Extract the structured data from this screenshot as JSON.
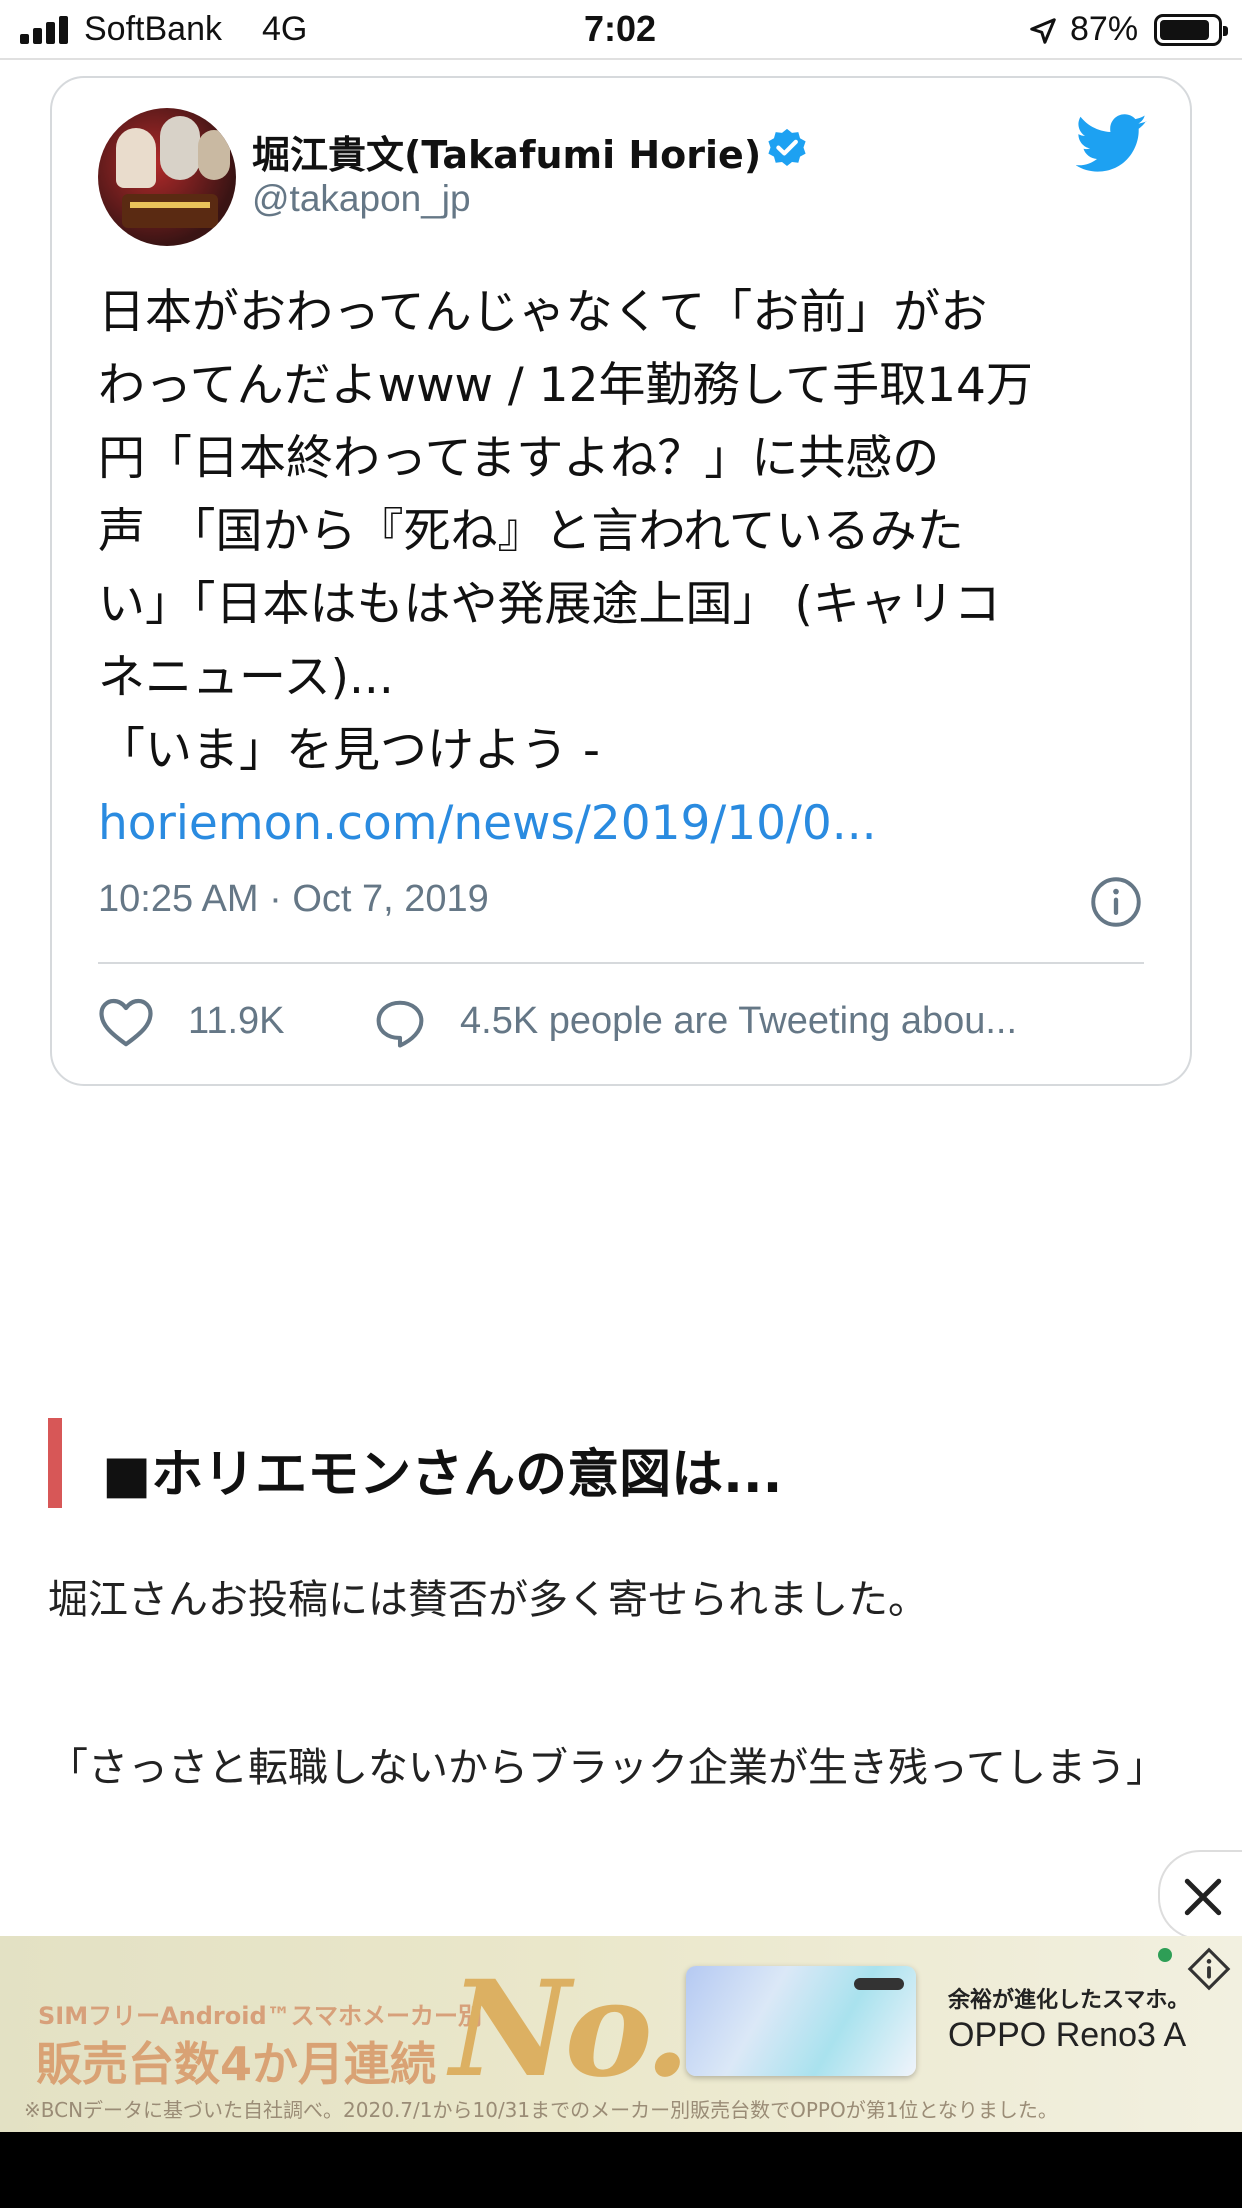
{
  "status_bar": {
    "carrier": "SoftBank",
    "network": "4G",
    "time": "7:02",
    "battery_percent": "87%",
    "battery_level": 0.87
  },
  "tweet": {
    "display_name": "堀江貴文(Takafumi Horie)",
    "handle": "@takapon_jp",
    "text_lines": [
      "日本がおわってんじゃなくて「お前」がお",
      "わってんだよwww / 12年勤務して手取14万",
      "円「日本終わってますよね？」に共感の",
      "声　「国から『死ね』と言われているみた",
      "い」「日本はもはや発展途上国」 (キャリコ",
      "ネニュース)...",
      "「いま」を見つけよう -"
    ],
    "link": "horiemon.com/news/2019/10/0...",
    "timestamp": "10:25 AM · Oct 7, 2019",
    "like_count": "11.9K",
    "reply_text": "4.5K people are Tweeting abou...",
    "colors": {
      "link": "#2a8be0",
      "verified": "#1da1f2",
      "twitter": "#1da1f2"
    }
  },
  "article": {
    "heading": "■ホリエモンさんの意図は...",
    "paragraph_1": "堀江さんお投稿には賛否が多く寄せられました。",
    "paragraph_2": "「さっさと転職しないからブラック企業が生き残ってしまう」",
    "accent_color": "#d75757"
  },
  "ad": {
    "tag": "SIMフリーAndroid™スマホメーカー別",
    "headline": "販売台数4か月連続",
    "badge": "No.1",
    "tagline": "余裕が進化したスマホ。",
    "product": "OPPO Reno3 A",
    "disclaimer": "※BCNデータに基づいた自社調べ。2020.7/1から10/31までのメーカー別販売台数でOPPOが第1位となりました。"
  }
}
